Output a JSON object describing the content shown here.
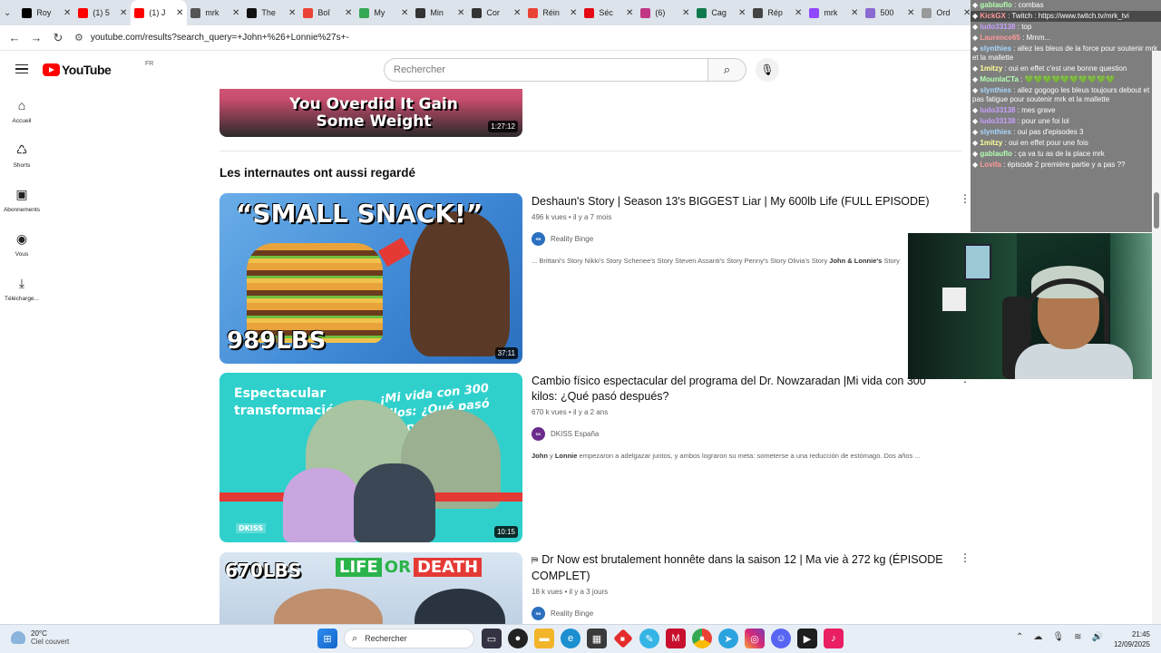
{
  "browser": {
    "tabs": [
      {
        "title": "Roy",
        "color": "#000000",
        "active": false
      },
      {
        "title": "(1) 5",
        "color": "#ff0000",
        "active": false
      },
      {
        "title": "(1) J",
        "color": "#ff0000",
        "active": true
      },
      {
        "title": "mrk",
        "color": "#555555",
        "active": false
      },
      {
        "title": "The",
        "color": "#111111",
        "active": false
      },
      {
        "title": "Boî",
        "color": "#ea4335",
        "active": false
      },
      {
        "title": "My",
        "color": "#34a853",
        "active": false
      },
      {
        "title": "Min",
        "color": "#333333",
        "active": false
      },
      {
        "title": "Cor",
        "color": "#333333",
        "active": false
      },
      {
        "title": "Réin",
        "color": "#ea4335",
        "active": false
      },
      {
        "title": "Séc",
        "color": "#e50914",
        "active": false
      },
      {
        "title": "(6)",
        "color": "#c13584",
        "active": false
      },
      {
        "title": "Cag",
        "color": "#0f7b4d",
        "active": false
      },
      {
        "title": "Rép",
        "color": "#444444",
        "active": false
      },
      {
        "title": "mrk",
        "color": "#9146ff",
        "active": false
      },
      {
        "title": "500",
        "color": "#8a6bd1",
        "active": false
      },
      {
        "title": "Ord",
        "color": "#999999",
        "active": false
      }
    ],
    "url": "youtube.com/results?search_query=+John+%26+Lonnie%27s+-"
  },
  "youtube": {
    "logo_text": "YouTube",
    "region": "FR",
    "search_placeholder": "Rechercher"
  },
  "sidebar": {
    "items": [
      {
        "label": "Accueil",
        "icon": "home-icon",
        "glyph": "⌂"
      },
      {
        "label": "Shorts",
        "icon": "shorts-icon",
        "glyph": "♺"
      },
      {
        "label": "Abonnements",
        "icon": "subscriptions-icon",
        "glyph": "▣"
      },
      {
        "label": "Vous",
        "icon": "you-icon",
        "glyph": "◉"
      },
      {
        "label": "Télécharge...",
        "icon": "download-icon",
        "glyph": "⤓"
      }
    ]
  },
  "results": {
    "top_video": {
      "thumb_text": "You Overdid It Gain Some Weight",
      "duration": "1:27:12"
    },
    "section_title": "Les internautes ont aussi regardé",
    "videos": [
      {
        "title": "Deshaun's Story | Season 13's BIGGEST Liar | My 600lb Life (FULL EPISODE)",
        "views": "496 k vues",
        "age": "il y a 7 mois",
        "channel": "Reality Binge",
        "desc_pre": "... Brittani's Story Nikki's Story Schenee's Story Steven Assanti's Story Penny's Story Olivia's Story ",
        "desc_bold": "John & Lonnie's",
        "desc_post": " Story",
        "duration": "37:11",
        "thumb_top": "“SMALL SNACK!”",
        "thumb_bottom": "989LBS"
      },
      {
        "title": "Cambio físico espectacular del programa del Dr. Nowzaradan |Mi vida con 300 kilos: ¿Qué pasó después?",
        "views": "670 k vues",
        "age": "il y a 2 ans",
        "channel": "DKISS España",
        "desc_pre": "",
        "desc_bold": "John",
        "desc_mid": " y ",
        "desc_bold2": "Lonnie",
        "desc_post": " empezaron a adelgazar juntos, y ambos lograron su meta: someterse a una reducción de estómago. Dos años ...",
        "duration": "10:15",
        "thumb_left": "Espectacular transformación",
        "thumb_right": "¡Mi vida con 300 kilos: ¿Qué pasó después?",
        "thumb_badge": "DKISS"
      },
      {
        "title": "Dr Now est brutalement honnête dans la saison 12 | Ma vie à 272 kg (ÉPISODE COMPLET)",
        "views": "18 k vues",
        "age": "il y a 3 jours",
        "channel": "Reality Binge",
        "thumb_a": "670LBS",
        "thumb_b": "LIFE",
        "thumb_c": "OR",
        "thumb_d": "DEATH"
      }
    ]
  },
  "chat": {
    "messages": [
      {
        "user": "gablauflo",
        "text": "combas",
        "cls": "c1"
      },
      {
        "user": "KickGX",
        "text": "Twitch : https://www.twitch.tv/mrk_tvi",
        "cls": "c3",
        "hl": true
      },
      {
        "user": "ludo33138",
        "text": "top",
        "cls": "c5"
      },
      {
        "user": "Laurence65",
        "text": "Mmm...",
        "cls": "c3"
      },
      {
        "user": "slynthies",
        "text": "allez les bleus de la force pour soutenir mrk et la mallette",
        "cls": "c2"
      },
      {
        "user": "1mitzy",
        "text": "oui en effet c'est une bonne question",
        "cls": "c4"
      },
      {
        "user": "MounIaCTa",
        "text": "💚💚💚💚💚💚💚💚💚💚",
        "cls": "c1"
      },
      {
        "user": "slynthies",
        "text": "allez gogogo les bleus toujours debout et pas fatigue pour soutenir mrk et la mallette",
        "cls": "c2"
      },
      {
        "user": "ludo33138",
        "text": "mes grave",
        "cls": "c5"
      },
      {
        "user": "ludo33138",
        "text": "pour une foi lol",
        "cls": "c5"
      },
      {
        "user": "slynthies",
        "text": "oui pas d'episodes 3",
        "cls": "c2"
      },
      {
        "user": "1mitzy",
        "text": "oui en effet pour une fois",
        "cls": "c4"
      },
      {
        "user": "gablauflo",
        "text": "ça va tu as de la place mrk",
        "cls": "c1"
      },
      {
        "user": "Lovifa",
        "text": "épisode 2 première partie y a pas ??",
        "cls": "c3"
      }
    ]
  },
  "taskbar": {
    "temp": "20°C",
    "weather": "Ciel couvert",
    "search_label": "Rechercher",
    "time": "21:45",
    "date": "12/09/2025"
  }
}
